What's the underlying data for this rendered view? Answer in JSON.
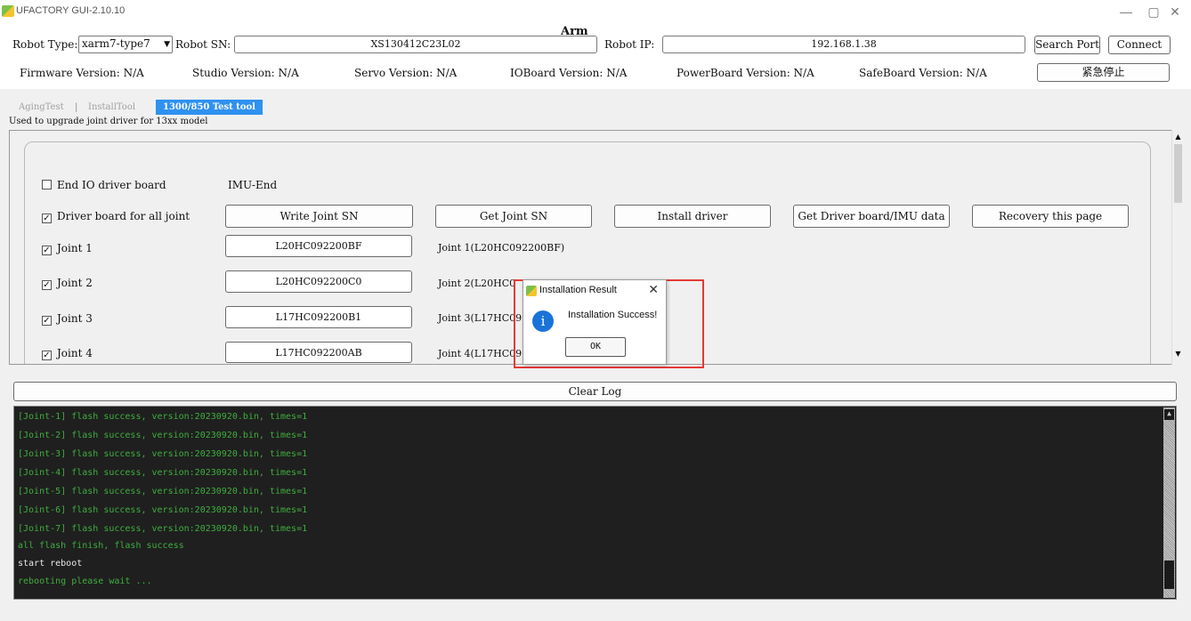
{
  "window": {
    "title": "UFACTORY GUI-2.10.10",
    "minimize": "—",
    "maximize": "▢",
    "close": "✕"
  },
  "header": {
    "robot_type_label": "Robot Type:",
    "robot_type_value": "xarm7-type7",
    "robot_sn_label": "Robot SN:",
    "robot_sn_value": "XS130412C23L02",
    "robot_ip_label": "Robot IP:",
    "robot_ip_value": "192.168.1.38",
    "search_port": "Search Port",
    "connect": "Connect",
    "firmware": "Firmware Version: N/A",
    "studio": "Studio Version: N/A",
    "servo": "Servo Version: N/A",
    "ioboard": "IOBoard Version: N/A",
    "powerboard": "PowerBoard Version: N/A",
    "safeboard": "SafeBoard Version: N/A",
    "estop": "紧急停止"
  },
  "tabs": {
    "items": [
      "AgingTest",
      "InstallTool",
      "1300/850 Test tool"
    ],
    "separator": "|",
    "description": "Used to upgrade joint driver for 13xx model"
  },
  "arm": {
    "title": "Arm",
    "end_io_label": "End IO driver board",
    "imu_label": "IMU-End",
    "driver_all_label": "Driver board for all joint",
    "buttons": [
      "Write Joint SN",
      "Get Joint SN",
      "Install driver",
      "Get Driver board/IMU data",
      "Recovery this page"
    ],
    "joints": [
      {
        "label": "Joint 1",
        "sn": "L20HC092200BF",
        "info": "Joint 1(L20HC092200BF)"
      },
      {
        "label": "Joint 2",
        "sn": "L20HC092200C0",
        "info": "Joint 2(L20HC0"
      },
      {
        "label": "Joint 3",
        "sn": "L17HC092200B1",
        "info": "Joint 3(L17HC09"
      },
      {
        "label": "Joint 4",
        "sn": "L17HC092200AB",
        "info": "Joint 4(L17HC09"
      }
    ],
    "check_mark": "✓"
  },
  "log": {
    "clear_label": "Clear Log",
    "lines": [
      {
        "text": "[Joint-1] flash success, version:20230920.bin, times=1",
        "color": "#3fae3f"
      },
      {
        "text": "[Joint-2] flash success, version:20230920.bin, times=1",
        "color": "#3fae3f"
      },
      {
        "text": "[Joint-3] flash success, version:20230920.bin, times=1",
        "color": "#3fae3f"
      },
      {
        "text": "[Joint-4] flash success, version:20230920.bin, times=1",
        "color": "#3fae3f"
      },
      {
        "text": "[Joint-5] flash success, version:20230920.bin, times=1",
        "color": "#3fae3f"
      },
      {
        "text": "[Joint-6] flash success, version:20230920.bin, times=1",
        "color": "#3fae3f"
      },
      {
        "text": "[Joint-7] flash success, version:20230920.bin, times=1",
        "color": "#3fae3f"
      },
      {
        "text": "all flash finish, flash success",
        "color": "#3fae3f"
      },
      {
        "text": "start reboot",
        "color": "#e8e8e8"
      },
      {
        "text": "rebooting please wait ...",
        "color": "#3fae3f"
      }
    ]
  },
  "dialog": {
    "title": "Installation Result",
    "message": "Installation Success!",
    "ok": "OK",
    "close": "✕",
    "info_icon": "i"
  },
  "scroll": {
    "up": "▲",
    "down": "▼"
  }
}
